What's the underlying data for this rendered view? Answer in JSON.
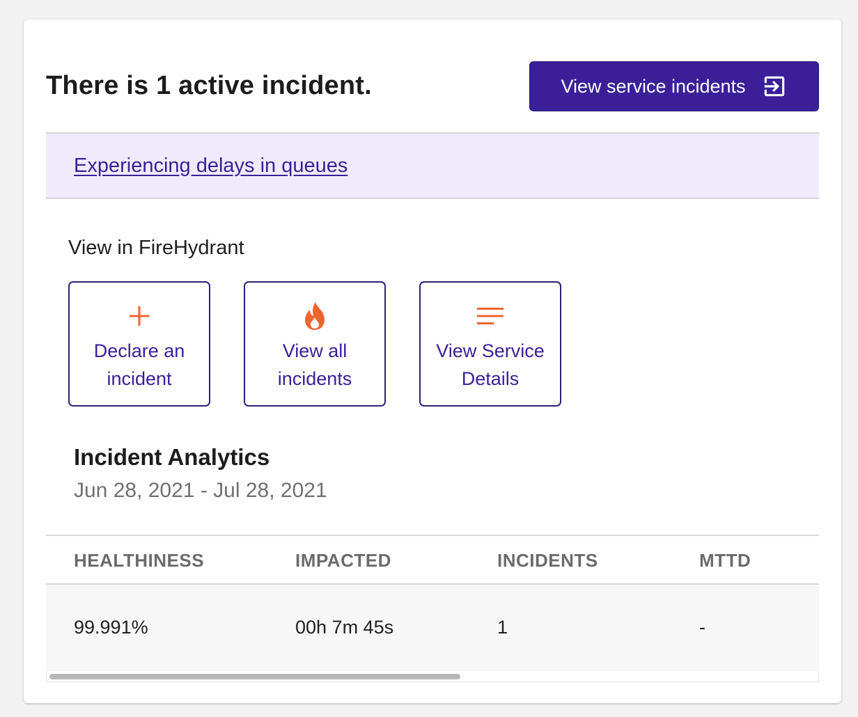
{
  "header": {
    "title": "There is 1 active incident.",
    "view_service_incidents_label": "View service incidents"
  },
  "active_incident": {
    "title": "Experiencing delays in queues"
  },
  "firehydrant": {
    "section_label": "View in FireHydrant",
    "actions": [
      {
        "icon": "plus-icon",
        "line1": "Declare an",
        "line2": "incident"
      },
      {
        "icon": "flame-icon",
        "line1": "View all",
        "line2": "incidents"
      },
      {
        "icon": "lines-icon",
        "line1": "View Service",
        "line2": "Details"
      }
    ]
  },
  "analytics": {
    "title": "Incident Analytics",
    "date_range": "Jun 28, 2021 - Jul 28, 2021",
    "columns": [
      "HEALTHINESS",
      "IMPACTED",
      "INCIDENTS",
      "MTTD"
    ],
    "row": [
      "99.991%",
      "00h 7m 45s",
      "1",
      "-"
    ]
  },
  "colors": {
    "brand_purple": "#3a1f98",
    "accent_orange": "#f0642f",
    "banner_bg": "#efebfc"
  }
}
